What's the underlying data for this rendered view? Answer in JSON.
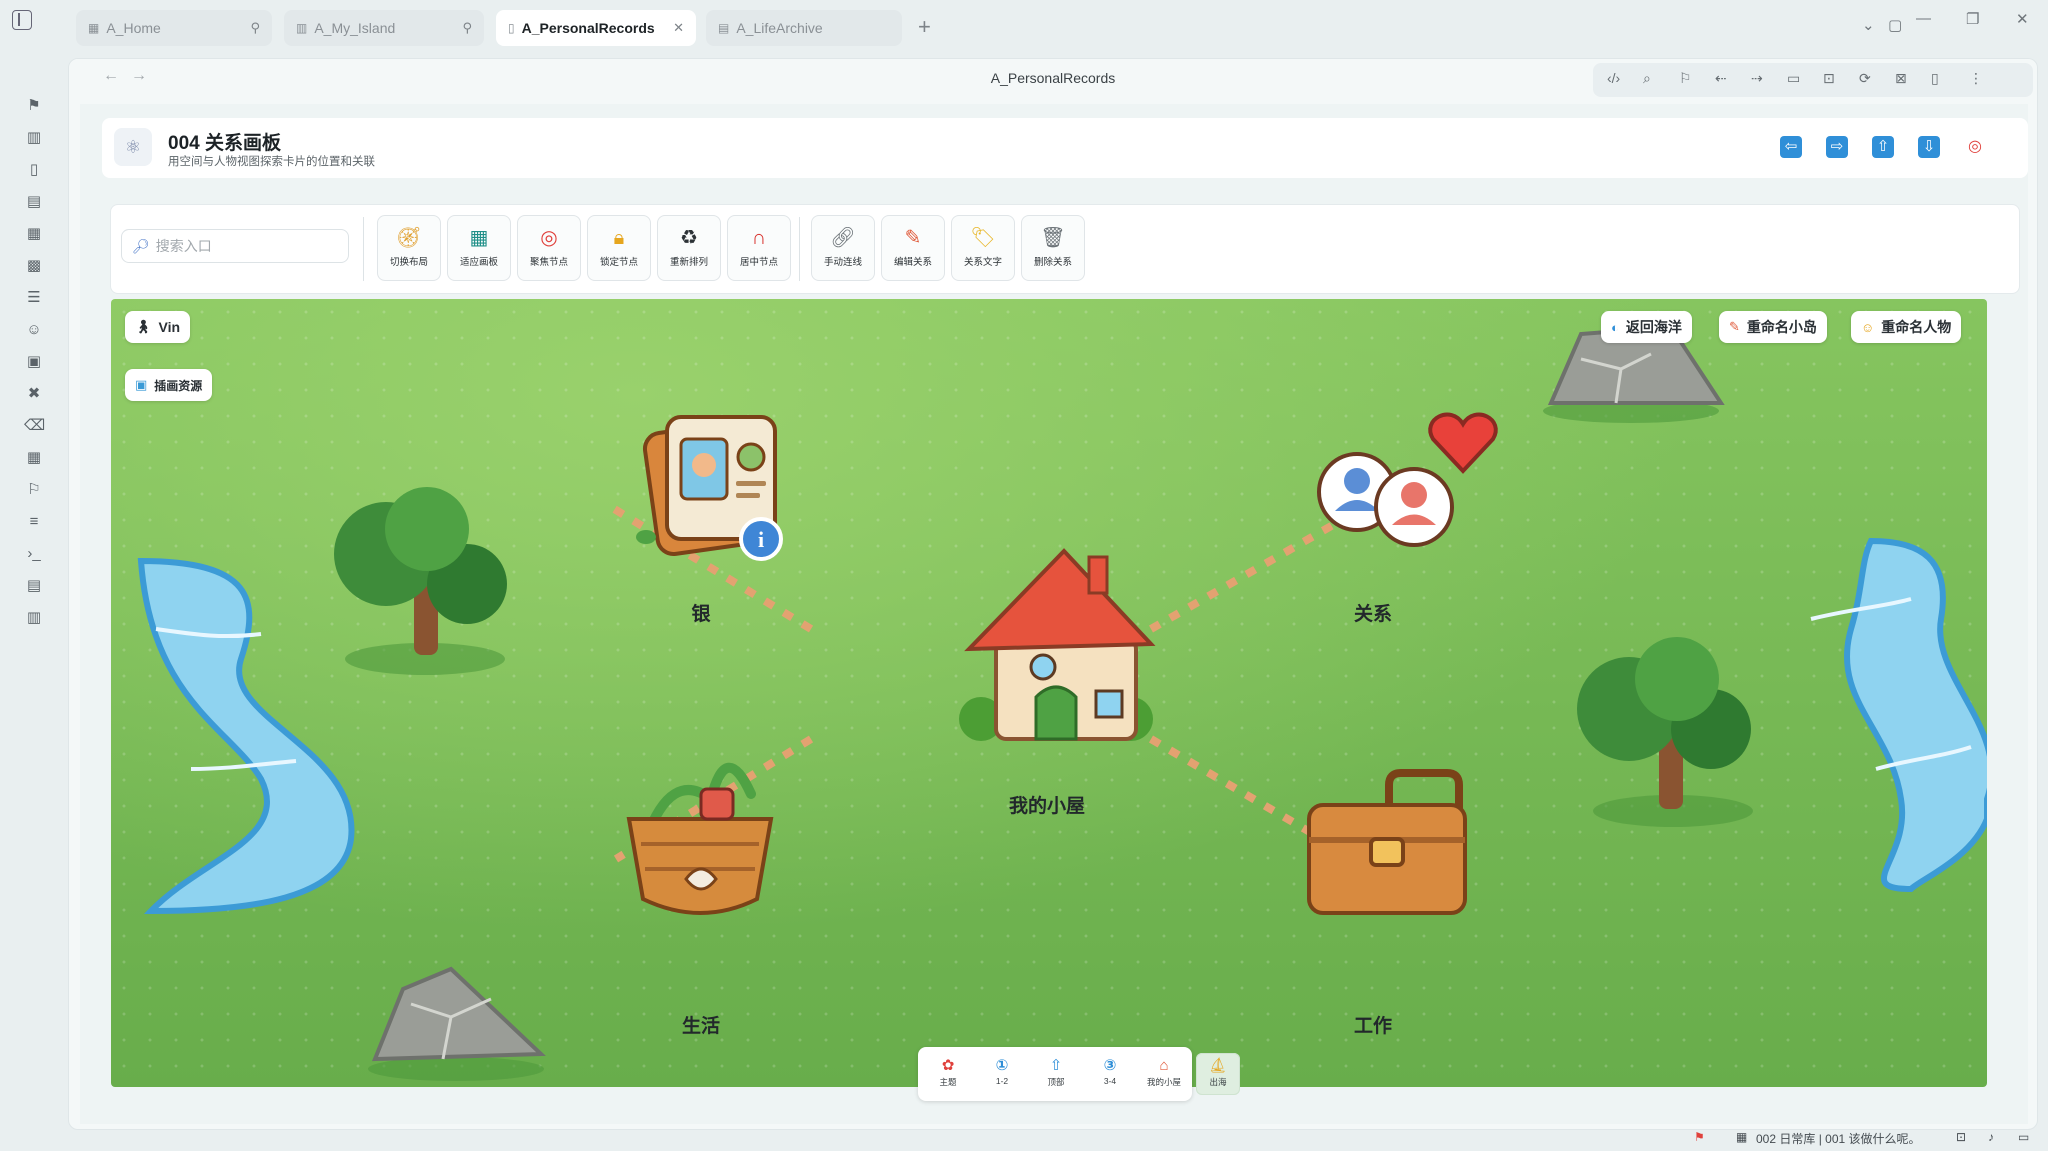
{
  "tabs": [
    {
      "label": "A_Home",
      "icon": "grid-icon",
      "end": "pin-icon"
    },
    {
      "label": "A_My_Island",
      "icon": "map-icon",
      "end": "pin-icon"
    },
    {
      "label": "A_PersonalRecords",
      "icon": "book-icon",
      "end": "close-icon"
    },
    {
      "label": "A_LifeArchive",
      "icon": "archive-icon",
      "end": ""
    }
  ],
  "nav": {
    "title": "A_PersonalRecords"
  },
  "header": {
    "title": "004 关系画板",
    "subtitle": "用空间与人物视图探索卡片的位置和关联",
    "arrows": [
      "arrow-left-icon",
      "arrow-right-icon",
      "arrow-up-icon",
      "arrow-down-icon",
      "target-icon"
    ]
  },
  "search": {
    "placeholder": "搜索入口"
  },
  "tools": [
    {
      "label": "切换布局",
      "icon": "compass-icon"
    },
    {
      "label": "适应画板",
      "icon": "map-fit-icon"
    },
    {
      "label": "聚焦节点",
      "icon": "target-icon"
    },
    {
      "label": "锁定节点",
      "icon": "lock-icon"
    },
    {
      "label": "重新排列",
      "icon": "recycle-icon"
    },
    {
      "label": "居中节点",
      "icon": "magnet-icon"
    },
    {
      "label": "手动连线",
      "icon": "link-icon"
    },
    {
      "label": "编辑关系",
      "icon": "pencil-icon"
    },
    {
      "label": "关系文字",
      "icon": "tag-icon"
    },
    {
      "label": "删除关系",
      "icon": "trash-icon"
    }
  ],
  "canvas": {
    "user_pill": "Vin",
    "assets_pill": "插画资源",
    "actions": [
      "返回海洋",
      "重命名小岛",
      "重命名人物"
    ],
    "nodes": {
      "center": "我的小屋",
      "top_left": "银",
      "top_right": "关系",
      "bottom_left": "生活",
      "bottom_right": "工作"
    }
  },
  "dock": [
    {
      "label": "主题",
      "icon": "palette-icon"
    },
    {
      "label": "1-2",
      "icon": "one-icon"
    },
    {
      "label": "顶部",
      "icon": "arrow-up-icon"
    },
    {
      "label": "3-4",
      "icon": "three-icon"
    },
    {
      "label": "我的小屋",
      "icon": "house-icon"
    },
    {
      "label": "出海",
      "icon": "sail-icon"
    }
  ],
  "status": {
    "text": "002 日常库 | 001 该做什么呢。"
  }
}
